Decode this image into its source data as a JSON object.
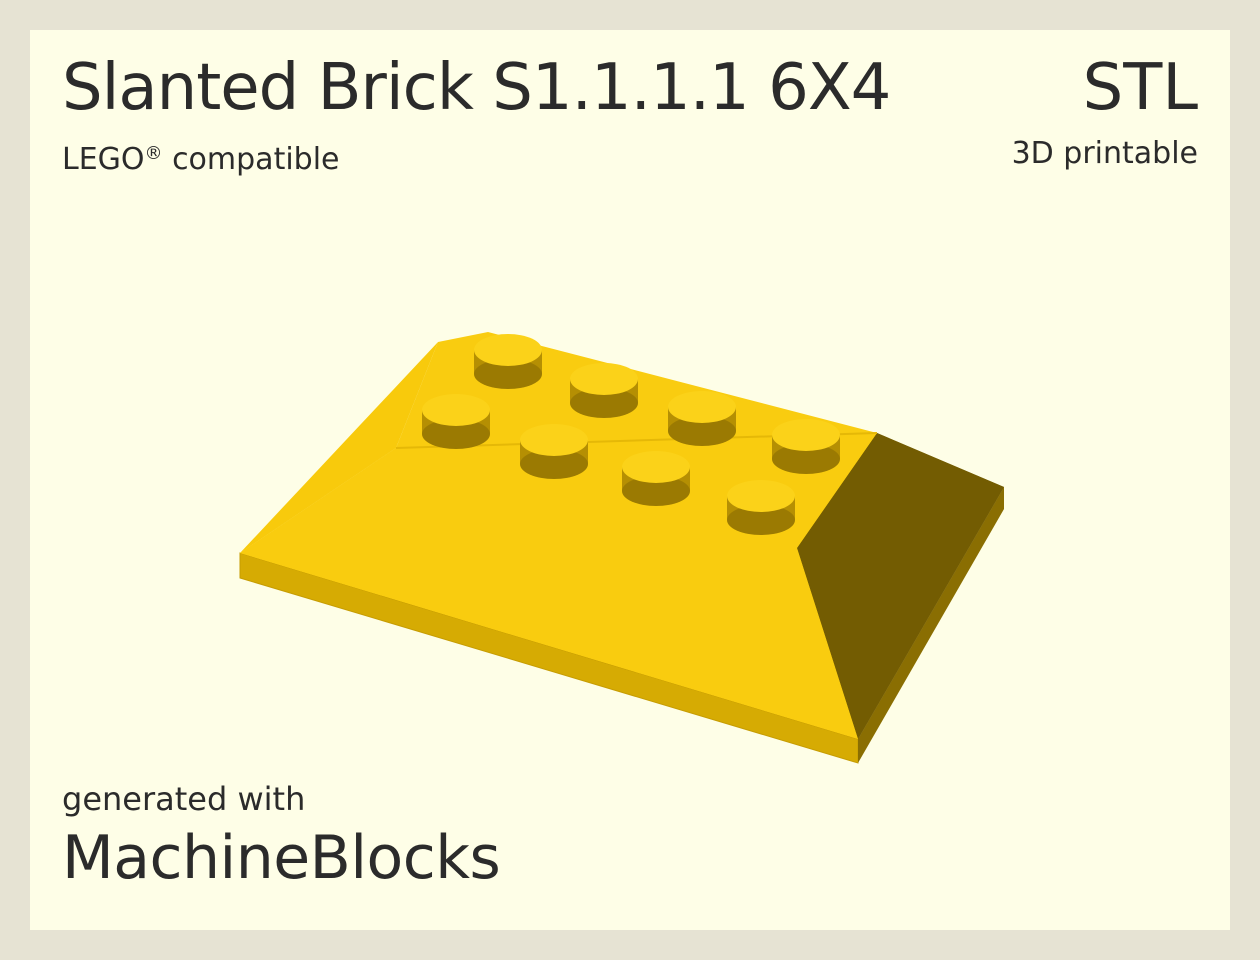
{
  "header": {
    "title": "Slanted Brick S1.1.1.1 6X4",
    "format": "STL",
    "subtitle_text": "LEGO",
    "subtitle_mark": "®",
    "subtitle_rest": " compatible",
    "printable": "3D printable"
  },
  "footer": {
    "generated": "generated with",
    "brand": "MachineBlocks"
  },
  "colors": {
    "background": "#e6e3d3",
    "card": "#fefee7",
    "text": "#2b2b2b",
    "brick_top": "#f9cc0f",
    "brick_side": "#735c02",
    "brick_edge": "#d9ad04"
  }
}
